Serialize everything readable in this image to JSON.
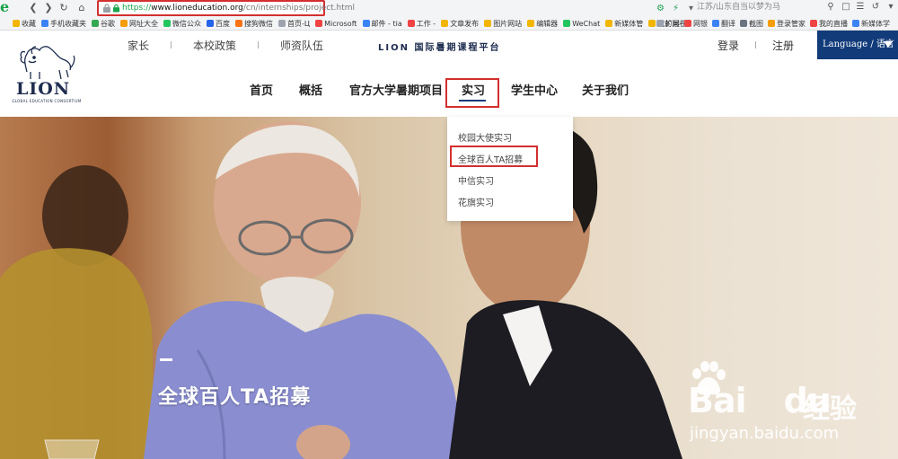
{
  "browser": {
    "url_prefix": "https://",
    "url_host": "www.lioneducation.org",
    "url_path": "/cn/internships/project.html",
    "hot_search": "江苏/山东自当以梦为马",
    "bookmarks": [
      {
        "label": "收藏",
        "color": "#f2b600"
      },
      {
        "label": "手机收藏夹",
        "color": "#3b82f6"
      },
      {
        "label": "谷歌",
        "color": "#34a853"
      },
      {
        "label": "网址大全",
        "color": "#f59e0b"
      },
      {
        "label": "微信公众",
        "color": "#22c55e"
      },
      {
        "label": "百度",
        "color": "#2563eb"
      },
      {
        "label": "搜狗微信",
        "color": "#f97316"
      },
      {
        "label": "首页-Ц",
        "color": "#9ca3af"
      },
      {
        "label": "Microsoft",
        "color": "#ef4444"
      },
      {
        "label": "邮件 - tia",
        "color": "#3b82f6"
      },
      {
        "label": "工作 -",
        "color": "#ef4444"
      },
      {
        "label": "文章发布",
        "color": "#f2b600"
      },
      {
        "label": "图片网站",
        "color": "#f2b600"
      },
      {
        "label": "编辑器",
        "color": "#f2b600"
      },
      {
        "label": "WeChat",
        "color": "#22c55e"
      },
      {
        "label": "新媒体管",
        "color": "#f2b600"
      },
      {
        "label": "我的问卷",
        "color": "#f2b600"
      }
    ],
    "bookmarks_right": [
      {
        "label": "扩展",
        "color": "#9ca3af"
      },
      {
        "label": "网银",
        "color": "#ef4444"
      },
      {
        "label": "翻译",
        "color": "#3b82f6"
      },
      {
        "label": "截图",
        "color": "#6b7280"
      },
      {
        "label": "登录管家",
        "color": "#f59e0b"
      },
      {
        "label": "我的直播",
        "color": "#ef4444"
      },
      {
        "label": "新媒体学",
        "color": "#3b82f6"
      }
    ]
  },
  "logo": {
    "text": "LION",
    "subtext": "GLOBAL EDUCATION CONSORTIUM"
  },
  "top_links": [
    "家长",
    "本校政策",
    "师资队伍"
  ],
  "platform": "LION 国际暑期课程平台",
  "auth": {
    "login": "登录",
    "register": "注册"
  },
  "language": "Language / 语言",
  "nav": {
    "items": [
      "首页",
      "概括",
      "官方大学暑期项目",
      "实习",
      "学生中心",
      "关于我们"
    ],
    "active": "实习"
  },
  "dropdown": {
    "items": [
      "校园大使实习",
      "全球百人TA招募",
      "中信实习",
      "花旗实习"
    ],
    "highlighted": "全球百人TA招募"
  },
  "hero": {
    "title": "全球百人TA招募"
  },
  "watermark": {
    "brand": "Bai",
    "brand_du": "du",
    "cn": "经验",
    "url": "jingyan.baidu.com"
  },
  "colors": {
    "accent": "#123b7a",
    "highlight": "#d32f2f",
    "brand": "#1e2c4f"
  }
}
